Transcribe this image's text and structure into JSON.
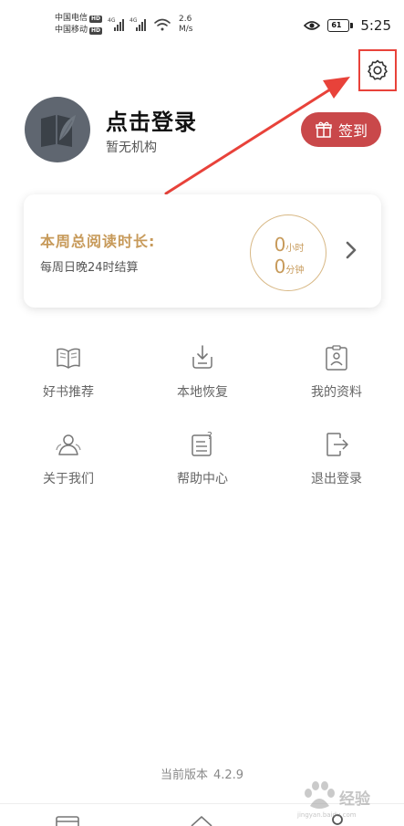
{
  "status_bar": {
    "carrier1": "中国电信",
    "carrier2": "中国移动",
    "hd_badge": "HD",
    "net_speed_value": "2.6",
    "net_speed_unit": "M/s",
    "battery": "61",
    "time": "5:25"
  },
  "profile": {
    "login_title": "点击登录",
    "organization": "暂无机构",
    "signin_label": "签到"
  },
  "reading_card": {
    "title": "本周总阅读时长:",
    "subtitle": "每周日晚24时结算",
    "hours_value": "0",
    "hours_unit": "小时",
    "minutes_value": "0",
    "minutes_unit": "分钟"
  },
  "menu": [
    {
      "label": "好书推荐",
      "icon": "open-book-icon"
    },
    {
      "label": "本地恢复",
      "icon": "restore-icon"
    },
    {
      "label": "我的资料",
      "icon": "profile-card-icon"
    },
    {
      "label": "关于我们",
      "icon": "team-icon"
    },
    {
      "label": "帮助中心",
      "icon": "help-document-icon"
    },
    {
      "label": "退出登录",
      "icon": "logout-icon"
    }
  ],
  "footer": {
    "version_label": "当前版本",
    "version_value": "4.2.9"
  },
  "watermark": {
    "text": "经验",
    "url": "jingyan.baidu.com"
  },
  "colors": {
    "accent_gold": "#c79a5a",
    "signin_red": "#c9484a",
    "annotation_red": "#e8423a",
    "avatar_gray": "#5f6670"
  }
}
